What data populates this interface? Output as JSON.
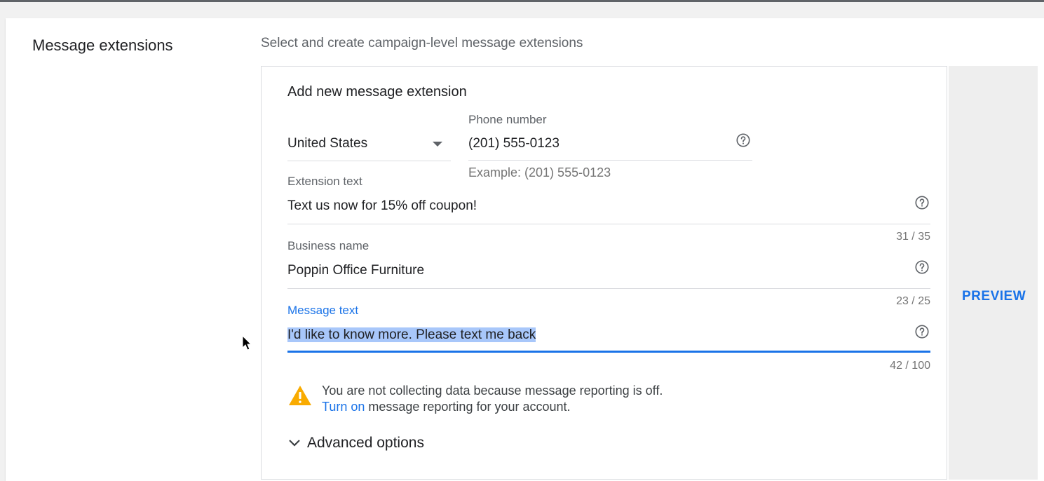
{
  "section": {
    "title": "Message extensions",
    "description": "Select and create campaign-level message extensions"
  },
  "form": {
    "heading": "Add new message extension",
    "country": {
      "value": "United States"
    },
    "phone": {
      "label": "Phone number",
      "value": "(201) 555-0123",
      "helper": "Example: (201) 555-0123"
    },
    "extension_text": {
      "label": "Extension text",
      "value": "Text us now for 15% off coupon!",
      "counter": "31 / 35"
    },
    "business_name": {
      "label": "Business name",
      "value": "Poppin Office Furniture",
      "counter": "23 / 25"
    },
    "message_text": {
      "label": "Message text",
      "value": "I'd like to know more. Please text me back",
      "counter": "42 / 100"
    },
    "warning": {
      "line1": "You are not collecting data because message reporting is off.",
      "link": "Turn on",
      "line2_rest": " message reporting for your account."
    },
    "advanced_options": "Advanced options"
  },
  "preview": {
    "label": "PREVIEW"
  },
  "colors": {
    "accent": "#1a73e8",
    "warning": "#f9ab00",
    "selection": "#a8c7fa"
  }
}
